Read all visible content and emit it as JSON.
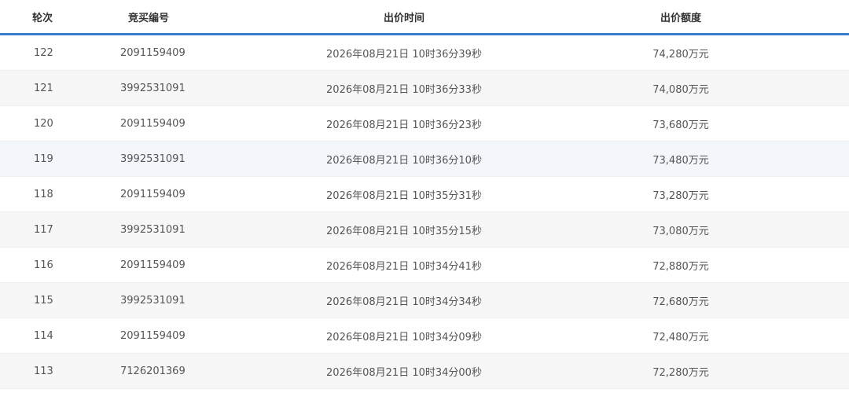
{
  "table": {
    "headers": {
      "round": "轮次",
      "bidder": "竞买编号",
      "time": "出价时间",
      "amount": "出价额度"
    },
    "rows": [
      {
        "round": "122",
        "bidder": "2091159409",
        "time": "2026年08月21日 10时36分39秒",
        "amount": "74,280万元"
      },
      {
        "round": "121",
        "bidder": "3992531091",
        "time": "2026年08月21日 10时36分33秒",
        "amount": "74,080万元"
      },
      {
        "round": "120",
        "bidder": "2091159409",
        "time": "2026年08月21日 10时36分23秒",
        "amount": "73,680万元"
      },
      {
        "round": "119",
        "bidder": "3992531091",
        "time": "2026年08月21日 10时36分10秒",
        "amount": "73,480万元"
      },
      {
        "round": "118",
        "bidder": "2091159409",
        "time": "2026年08月21日 10时35分31秒",
        "amount": "73,280万元"
      },
      {
        "round": "117",
        "bidder": "3992531091",
        "time": "2026年08月21日 10时35分15秒",
        "amount": "73,080万元"
      },
      {
        "round": "116",
        "bidder": "2091159409",
        "time": "2026年08月21日 10时34分41秒",
        "amount": "72,880万元"
      },
      {
        "round": "115",
        "bidder": "3992531091",
        "time": "2026年08月21日 10时34分34秒",
        "amount": "72,680万元"
      },
      {
        "round": "114",
        "bidder": "2091159409",
        "time": "2026年08月21日 10时34分09秒",
        "amount": "72,480万元"
      },
      {
        "round": "113",
        "bidder": "7126201369",
        "time": "2026年08月21日 10时34分00秒",
        "amount": "72,280万元"
      }
    ]
  },
  "colors": {
    "header_border": "#3a7ccf",
    "row_stripe": "#f7f7f7",
    "row_highlight": "#f3f6fb",
    "text": "#555555"
  }
}
